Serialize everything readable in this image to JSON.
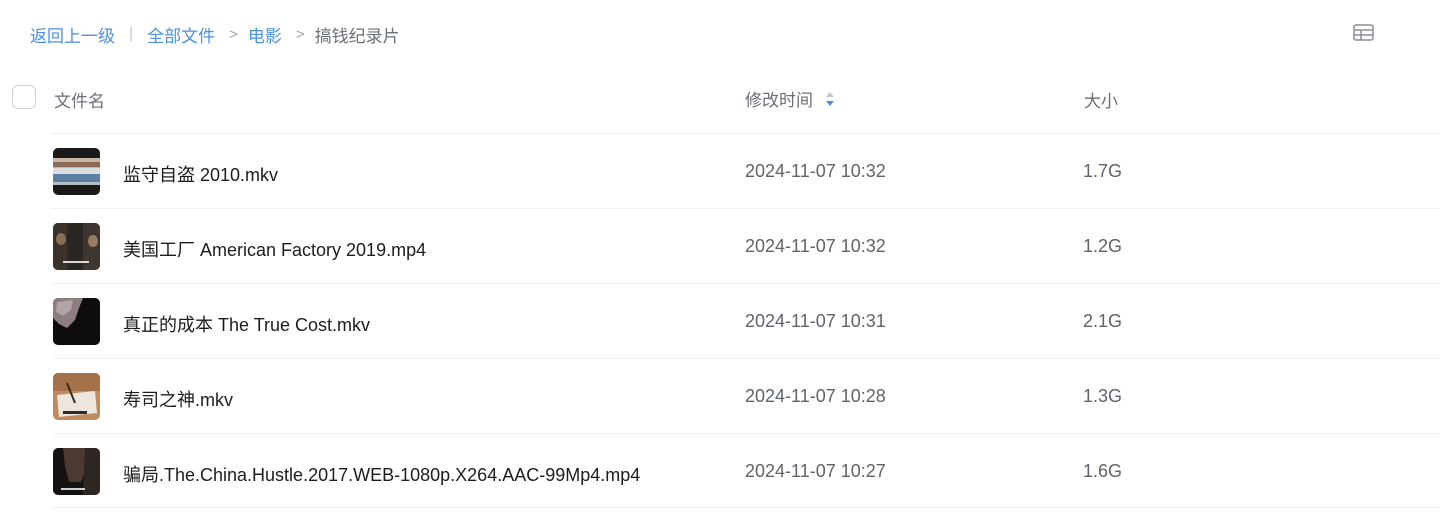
{
  "breadcrumb": {
    "back_label": "返回上一级",
    "separator": "|",
    "all_files_label": "全部文件",
    "arrow": ">",
    "folder_label": "电影",
    "current_label": "搞钱纪录片"
  },
  "table": {
    "col_name": "文件名",
    "col_time": "修改时间",
    "col_size": "大小",
    "sort": "descending"
  },
  "files": [
    {
      "name": "监守自盗 2010.mkv",
      "modified": "2024-11-07 10:32",
      "size": "1.7G",
      "thumb": "video-thumbnail"
    },
    {
      "name": "美国工厂 American Factory 2019.mp4",
      "modified": "2024-11-07 10:32",
      "size": "1.2G",
      "thumb": "video-thumbnail"
    },
    {
      "name": "真正的成本 The True Cost.mkv",
      "modified": "2024-11-07 10:31",
      "size": "2.1G",
      "thumb": "video-thumbnail"
    },
    {
      "name": "寿司之神.mkv",
      "modified": "2024-11-07 10:28",
      "size": "1.3G",
      "thumb": "video-thumbnail"
    },
    {
      "name": "骗局.The.China.Hustle.2017.WEB-1080p.X264.AAC-99Mp4.mp4",
      "modified": "2024-11-07 10:27",
      "size": "1.6G",
      "thumb": "video-thumbnail"
    }
  ],
  "colors": {
    "link": "#4a90e2",
    "sort_active": "#4a90e2"
  }
}
